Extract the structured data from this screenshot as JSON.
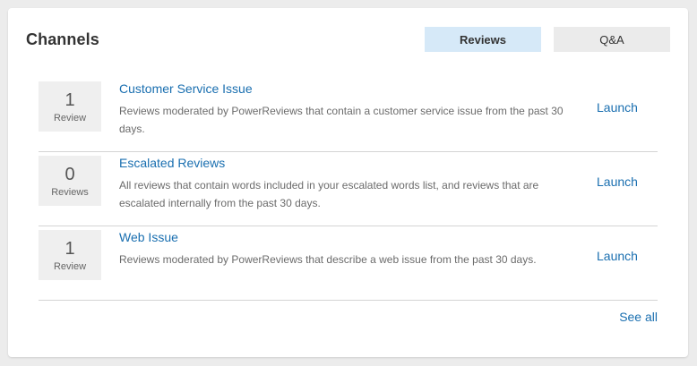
{
  "card": {
    "title": "Channels",
    "tabs": {
      "reviews": "Reviews",
      "qa": "Q&A"
    },
    "active_tab": "Reviews"
  },
  "channels": [
    {
      "count": "1",
      "unit": "Review",
      "title": "Customer Service Issue",
      "description": "Reviews moderated by PowerReviews that contain a customer service issue from the past 30 days.",
      "action": "Launch"
    },
    {
      "count": "0",
      "unit": "Reviews",
      "title": "Escalated Reviews",
      "description": "All reviews that contain words included in your escalated words list, and reviews that are escalated internally from the past 30 days.",
      "action": "Launch"
    },
    {
      "count": "1",
      "unit": "Review",
      "title": "Web Issue",
      "description": "Reviews moderated by PowerReviews that describe a web issue from the past 30 days.",
      "action": "Launch"
    }
  ],
  "footer": {
    "see_all": "See all"
  },
  "colors": {
    "link": "#1a6fb0",
    "active_tab_bg": "#d6e9f8",
    "inactive_tab_bg": "#ebebeb"
  }
}
